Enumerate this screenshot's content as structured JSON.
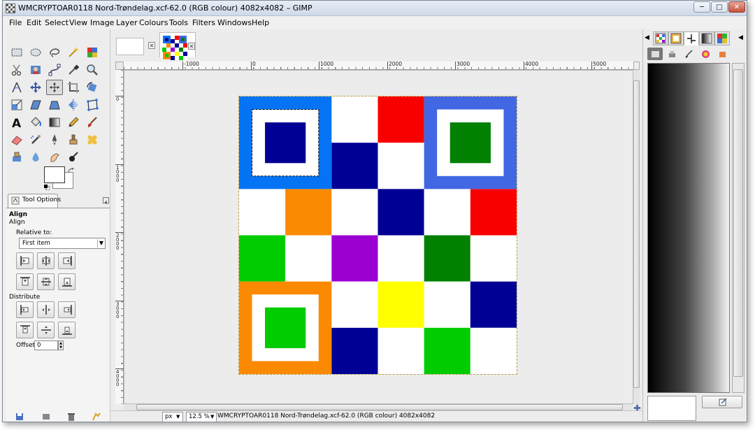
{
  "window": {
    "title": "WMCRYPTOAR0118 Nord-Trøndelag.xcf-62.0 (RGB colour) 4082x4082 – GIMP",
    "controls": {
      "minimize": "─",
      "maximize": "□",
      "close": "✕"
    }
  },
  "menubar": {
    "items": [
      {
        "label": "File"
      },
      {
        "label": "Edit"
      },
      {
        "label": "Select"
      },
      {
        "label": "View"
      },
      {
        "label": "Image"
      },
      {
        "label": "Layer"
      },
      {
        "label": "Colours"
      },
      {
        "label": "Tools"
      },
      {
        "label": "Filters"
      },
      {
        "label": "Windows"
      },
      {
        "label": "Help"
      }
    ]
  },
  "toolbox": {
    "tools": [
      "rect-select",
      "ellipse-select",
      "free-select",
      "fuzzy-select",
      "select-by-color",
      "scissors-select",
      "foreground-select",
      "paths",
      "color-picker",
      "zoom",
      "measure",
      "move",
      "align",
      "crop",
      "rotate",
      "scale",
      "shear",
      "perspective",
      "flip",
      "cage-transform",
      "text",
      "bucket-fill",
      "blend",
      "pencil",
      "paintbrush",
      "eraser",
      "airbrush",
      "ink",
      "clone",
      "heal",
      "perspective-clone",
      "blur",
      "smudge",
      "dodge-burn"
    ],
    "active_tool": "align",
    "colors": {
      "foreground": "#ffffff",
      "background": "#ffffff"
    }
  },
  "tool_options": {
    "tab_label": "Tool Options",
    "heading": "Align",
    "subheading": "Align",
    "relative_to_label": "Relative to:",
    "relative_to_value": "First item",
    "distribute_label": "Distribute",
    "offset_label": "Offset:",
    "offset_value": "0"
  },
  "image_window": {
    "ruler_labels_h": [
      "-1000",
      "0",
      "1000",
      "2000",
      "3000",
      "4000",
      "5000"
    ],
    "ruler_labels_v": [
      "0",
      "1000",
      "2000",
      "3000",
      "4000"
    ],
    "tab_close": "✕",
    "unit": "px",
    "zoom": "12.5 %",
    "status": "WMCRYPTOAR0118 Nord-Trøndelag.xcf-62.0 (RGB colour) 4082x4082"
  },
  "grid": {
    "colors": {
      "blue": "#0474f4",
      "darkblue": "#000094",
      "red": "#f80000",
      "royal": "#4267e3",
      "darkgreen": "#018001",
      "orange": "#fc8902",
      "green": "#00cc00",
      "purple": "#9b00d3",
      "yellow": "#ffff00",
      "white": "#ffffff"
    },
    "big_squares": [
      {
        "frame": "#0474f4",
        "inner": "#000094",
        "pos": "top-left",
        "selected": true
      },
      {
        "frame": "#4267e3",
        "inner": "#018001",
        "pos": "top-right",
        "selected": false
      },
      {
        "frame": "#fc8902",
        "inner": "#00cc00",
        "pos": "bottom-left",
        "selected": false
      }
    ],
    "cells": [
      {
        "r": 0,
        "c": 2,
        "color": "#ffffff"
      },
      {
        "r": 0,
        "c": 3,
        "color": "#f80000"
      },
      {
        "r": 1,
        "c": 2,
        "color": "#000094"
      },
      {
        "r": 1,
        "c": 3,
        "color": "#ffffff"
      },
      {
        "r": 2,
        "c": 0,
        "color": "#ffffff"
      },
      {
        "r": 2,
        "c": 1,
        "color": "#fc8902"
      },
      {
        "r": 2,
        "c": 2,
        "color": "#ffffff"
      },
      {
        "r": 2,
        "c": 3,
        "color": "#000094"
      },
      {
        "r": 2,
        "c": 4,
        "color": "#ffffff"
      },
      {
        "r": 2,
        "c": 5,
        "color": "#f80000"
      },
      {
        "r": 3,
        "c": 0,
        "color": "#00cc00"
      },
      {
        "r": 3,
        "c": 1,
        "color": "#ffffff"
      },
      {
        "r": 3,
        "c": 2,
        "color": "#9b00d3"
      },
      {
        "r": 3,
        "c": 3,
        "color": "#ffffff"
      },
      {
        "r": 3,
        "c": 4,
        "color": "#018001"
      },
      {
        "r": 3,
        "c": 5,
        "color": "#ffffff"
      },
      {
        "r": 4,
        "c": 2,
        "color": "#ffffff"
      },
      {
        "r": 4,
        "c": 3,
        "color": "#ffff00"
      },
      {
        "r": 4,
        "c": 4,
        "color": "#ffffff"
      },
      {
        "r": 4,
        "c": 5,
        "color": "#000094"
      },
      {
        "r": 5,
        "c": 2,
        "color": "#000094"
      },
      {
        "r": 5,
        "c": 3,
        "color": "#ffffff"
      },
      {
        "r": 5,
        "c": 4,
        "color": "#00cc00"
      },
      {
        "r": 5,
        "c": 5,
        "color": "#ffffff"
      }
    ]
  },
  "dock": {
    "tabs": [
      "patterns-icon",
      "brushes-icon",
      "fonts-icon",
      "gradients-icon",
      "palettes-icon"
    ],
    "subtabs": [
      "tool-presets-icon",
      "devices-icon",
      "paint-dynamics-icon",
      "colors-icon",
      "undo-icon"
    ]
  }
}
